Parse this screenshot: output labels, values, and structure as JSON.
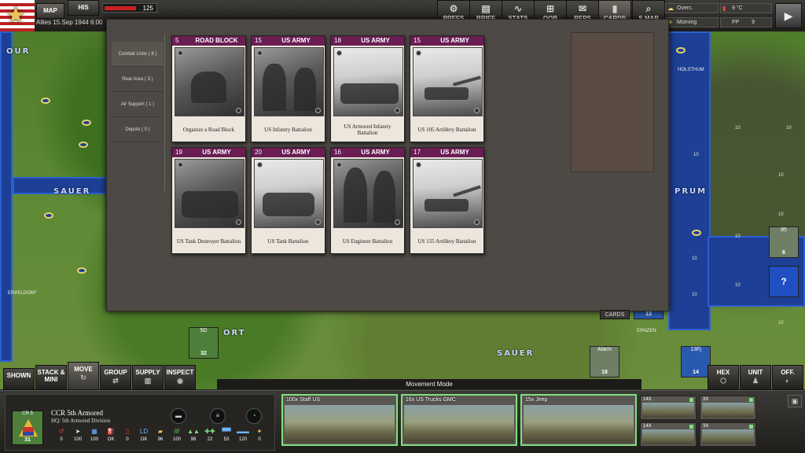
{
  "topbar": {
    "map_tab": "MAP",
    "his_tab": "HIS",
    "side_date": "Allies 15.Sep 1944 6:00",
    "victory_points": "125"
  },
  "menu": [
    {
      "label": "PREFS",
      "icon": "gear-icon",
      "glyph": "⚙"
    },
    {
      "label": "BRIEF",
      "icon": "document-icon",
      "glyph": "▤"
    },
    {
      "label": "STATS",
      "icon": "chart-icon",
      "glyph": "∿"
    },
    {
      "label": "OOB",
      "icon": "hierarchy-icon",
      "glyph": "⊞"
    },
    {
      "label": "REPS",
      "icon": "reports-icon",
      "glyph": "✉"
    },
    {
      "label": "CARDS",
      "icon": "cards-icon",
      "glyph": "▮"
    },
    {
      "label": "S.MAP",
      "icon": "strategic-map-icon",
      "glyph": "⌕"
    }
  ],
  "weather": {
    "condition": "Overc.",
    "temperature": "9 °C",
    "time_of_day": "Morning",
    "pp_label": "PP",
    "pp_value": "9"
  },
  "cards_panel": {
    "categories": [
      {
        "label": "Combat Units ( 8 )"
      },
      {
        "label": "Rear Area ( 3 )"
      },
      {
        "label": "Air Support ( 1 )"
      },
      {
        "label": "Depots ( 0 )"
      }
    ],
    "cards": [
      {
        "cost": "5",
        "faction": "ROAD BLOCK",
        "title": "Organize a Road Block",
        "photo": "dark"
      },
      {
        "cost": "15",
        "faction": "US ARMY",
        "title": "US Infantry Battalion",
        "photo": "dark"
      },
      {
        "cost": "18",
        "faction": "US ARMY",
        "title": "US Armored Infantry Battalion",
        "photo": "snow"
      },
      {
        "cost": "15",
        "faction": "US ARMY",
        "title": "US 105 Artillery Battalion",
        "photo": "snow"
      },
      {
        "cost": "19",
        "faction": "US ARMY",
        "title": "US Tank Destroyer Battalion",
        "photo": "dark"
      },
      {
        "cost": "20",
        "faction": "US ARMY",
        "title": "US Tank Battalion",
        "photo": "snow"
      },
      {
        "cost": "16",
        "faction": "US ARMY",
        "title": "US Engineer Battalion",
        "photo": "dark"
      },
      {
        "cost": "17",
        "faction": "US ARMY",
        "title": "US 155 Artillery Battalion",
        "photo": "snow"
      }
    ],
    "cards_tab": "CARDS"
  },
  "map": {
    "labels": [
      "OUR",
      "SAUER",
      "PRUM",
      "SAUER",
      "ORT",
      "ERNZEN",
      "HOLSTHUM",
      "ERPELDORF"
    ],
    "hex_values": [
      "10",
      "10",
      "10",
      "10",
      "10",
      "10",
      "10",
      "10",
      "10",
      "10"
    ],
    "counters": [
      {
        "strength": "32",
        "name": "5D"
      },
      {
        "strength": "18",
        "name": "Alarm"
      },
      {
        "strength": "14",
        "name": "13Fj"
      },
      {
        "strength": "6",
        "name": "85"
      },
      {
        "strength": "13",
        "name": ""
      },
      {
        "strength": "?",
        "name": ""
      }
    ]
  },
  "modes": [
    {
      "label": "SHOWN",
      "glyph": ""
    },
    {
      "label": "STACK & MINI",
      "glyph": ""
    },
    {
      "label": "MOVE",
      "glyph": "↻"
    },
    {
      "label": "GROUP",
      "glyph": "⇄"
    },
    {
      "label": "SUPPLY",
      "glyph": "▥"
    },
    {
      "label": "INSPECT",
      "glyph": "◉"
    },
    {
      "label": "HEX",
      "glyph": "⬡"
    },
    {
      "label": "UNIT",
      "glyph": "♟"
    },
    {
      "label": "OFF.",
      "glyph": "◐"
    }
  ],
  "mode_title": "Movement Mode",
  "unit": {
    "badge_label": "CR 5",
    "strength": "31",
    "name": "CCR 5th Armored",
    "hq": "HQ: 5th Armored Division",
    "stats": [
      {
        "icon": "morale-icon",
        "glyph": "↺",
        "value": "0",
        "color": "#e04a3a"
      },
      {
        "icon": "readiness-icon",
        "glyph": "➤",
        "value": "100",
        "color": "#e0e0e0"
      },
      {
        "icon": "supply-icon",
        "glyph": "▦",
        "value": "100",
        "color": "#6fb4ff"
      },
      {
        "icon": "fuel-icon",
        "glyph": "⛽",
        "value": "OK",
        "color": "#e04a3a"
      },
      {
        "icon": "ammo-icon",
        "glyph": "▯",
        "value": "0",
        "color": "#e04a3a"
      },
      {
        "icon": "entrench-icon",
        "glyph": "LD",
        "value": "OK",
        "color": "#6fb4ff"
      },
      {
        "icon": "experience-icon",
        "glyph": "▰",
        "value": "96",
        "color": "#f2c94c"
      },
      {
        "icon": "efficiency-icon",
        "glyph": "///",
        "value": "100",
        "color": "#7fe07f"
      },
      {
        "icon": "soft-attack-icon",
        "glyph": "▲▲",
        "value": "98",
        "color": "#7fe07f"
      },
      {
        "icon": "hard-attack-icon",
        "glyph": "✚✚",
        "value": "22",
        "color": "#7fe07f"
      },
      {
        "icon": "defense-icon",
        "glyph": "▀▀",
        "value": "53",
        "color": "#6fb4ff"
      },
      {
        "icon": "movement-icon",
        "glyph": "▬▬",
        "value": "120",
        "color": "#6fb4ff"
      },
      {
        "icon": "action-icon",
        "glyph": "✦",
        "value": "0",
        "color": "#f2c94c"
      }
    ]
  },
  "subunits": [
    {
      "label": "100x Staff US"
    },
    {
      "label": "16x US Trucks GMC"
    },
    {
      "label": "15x Jeep"
    }
  ],
  "mini_units": [
    {
      "label": "14X"
    },
    {
      "label": "3X"
    },
    {
      "label": "14X"
    },
    {
      "label": "3X"
    }
  ]
}
